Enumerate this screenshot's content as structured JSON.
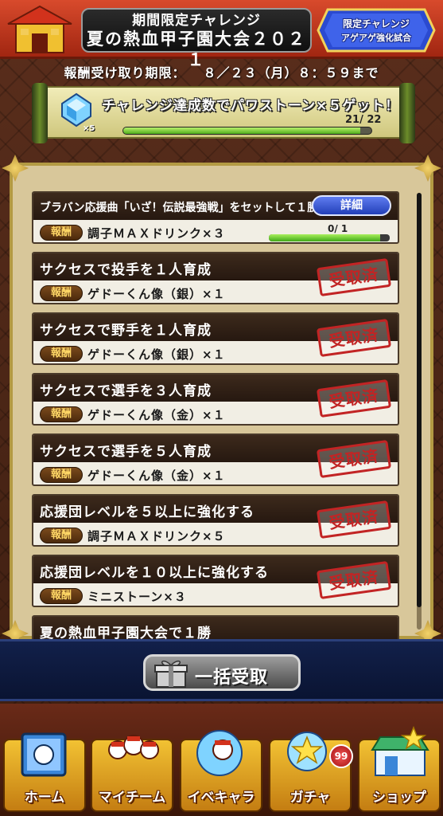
{
  "header": {
    "title_line1": "期間限定チャレンジ",
    "title_line2": "夏の熱血甲子園大会２０２１",
    "badge_line1": "限定チャレンジ",
    "badge_line2": "アゲアゲ強化試合"
  },
  "deadline": {
    "label": "報酬受け取り期限：",
    "value": "８／２３（月）８：５９まで"
  },
  "challenge_banner": {
    "text": "チャレンジ達成数でパワストーン×５ゲット！",
    "gem_count": "×5",
    "progress_text": "21/ 22",
    "progress_fraction": 0.955
  },
  "missions": {
    "reward_tag": "報酬",
    "claimed_stamp": "受取済",
    "detail_button": "詳細",
    "items": [
      {
        "title": "ブラバン応援曲「いざ！伝説最強戦」をセットして１勝",
        "reward": "調子ＭＡＸドリンク×３",
        "progress_text": "0/ 1",
        "progress_fraction": 0.0
      },
      {
        "title": "サクセスで投手を１人育成",
        "reward": "ゲドーくん像（銀）×１"
      },
      {
        "title": "サクセスで野手を１人育成",
        "reward": "ゲドーくん像（銀）×１"
      },
      {
        "title": "サクセスで選手を３人育成",
        "reward": "ゲドーくん像（金）×１"
      },
      {
        "title": "サクセスで選手を５人育成",
        "reward": "ゲドーくん像（金）×１"
      },
      {
        "title": "応援団レベルを５以上に強化する",
        "reward": "調子ＭＡＸドリンク×５"
      },
      {
        "title": "応援団レベルを１０以上に強化する",
        "reward": "ミニストーン×３"
      },
      {
        "title": "夏の熱血甲子園大会で１勝",
        "reward": ""
      }
    ]
  },
  "bulk_button": "一括受取",
  "nav": {
    "items": [
      {
        "label": "ホーム",
        "icon": "home-icon"
      },
      {
        "label": "マイチーム",
        "icon": "team-icon"
      },
      {
        "label": "イベキャラ",
        "icon": "event-character-icon"
      },
      {
        "label": "ガチャ",
        "icon": "gacha-icon"
      },
      {
        "label": "ショップ",
        "icon": "shop-icon"
      }
    ],
    "gacha_badge": "99"
  },
  "colors": {
    "header_red": "#c23a1f",
    "banner_blue": "#2b4ad0",
    "stamp_red": "#c22424",
    "progress_green": "#4fae1c",
    "nav_gold": "#f2c233"
  }
}
